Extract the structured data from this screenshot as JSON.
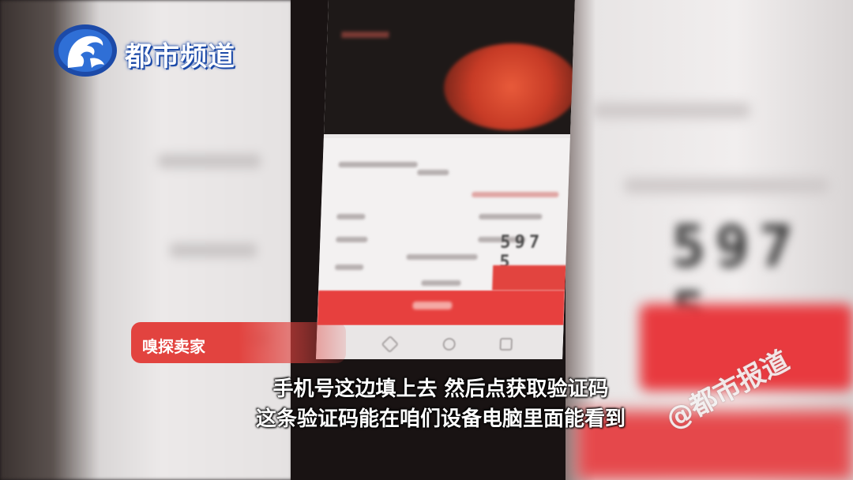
{
  "channel": {
    "logo_name": "dushi-pindao-logo",
    "name": "都市频道"
  },
  "phone_screen": {
    "code_digits": "597 5"
  },
  "caption": {
    "tag": "嗅探卖家",
    "line1": "手机号这边填上去 然后点获取验证码",
    "line2": "这条验证码能在咱们设备电脑里面能看到"
  },
  "watermark": {
    "text": "@都市报道"
  },
  "colors": {
    "logo_blue": "#1c4aa8",
    "accent_red": "#e2433f"
  }
}
